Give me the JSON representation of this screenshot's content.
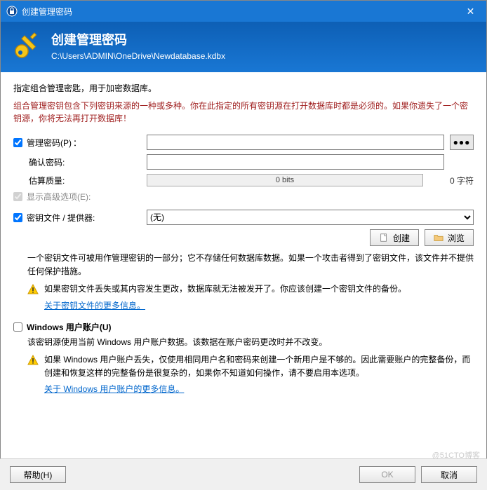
{
  "titlebar": {
    "title": "创建管理密码"
  },
  "header": {
    "title": "创建管理密码",
    "path": "C:\\Users\\ADMIN\\OneDrive\\Newdatabase.kdbx"
  },
  "intro": {
    "line1": "指定组合管理密匙，用于加密数据库。",
    "line2": "组合管理密钥包含下列密钥来源的一种或多种。你在此指定的所有密钥源在打开数据库时都是必须的。如果你遗失了一个密钥源，你将无法再打开数据库！"
  },
  "password": {
    "label": "管理密码(P)",
    "confirm_label": "确认密码:",
    "quality_label": "估算质量:",
    "quality_value": "0 bits",
    "chars": "0 字符",
    "reveal": "●●●"
  },
  "advanced": {
    "label": "显示高级选项(E):"
  },
  "keyfile": {
    "label": "密钥文件 / 提供器:",
    "selected": "(无)",
    "create": "创建",
    "browse": "浏览",
    "desc": "一个密钥文件可被用作管理密钥的一部分；它不存储任何数据库数据。如果一个攻击者得到了密钥文件，该文件并不提供任何保护措施。",
    "warn": "如果密钥文件丢失或其内容发生更改，数据库就无法被发开了。你应该创建一个密钥文件的备份。",
    "link": "关于密钥文件的更多信息。"
  },
  "windows": {
    "label": "Windows 用户账户(U)",
    "desc": "该密钥源使用当前 Windows 用户账户数据。该数据在账户密码更改时并不改变。",
    "warn": "如果 Windows 用户账户丢失，仅使用相同用户名和密码来创建一个新用户是不够的。因此需要账户的完整备份，而创建和恢复这样的完整备份是很复杂的，如果你不知道如何操作，请不要启用本选项。",
    "link": "关于 Windows 用户账户的更多信息。"
  },
  "footer": {
    "help": "帮助(H)",
    "ok": "OK",
    "cancel": "取消"
  },
  "watermark": "@51CTO博客"
}
